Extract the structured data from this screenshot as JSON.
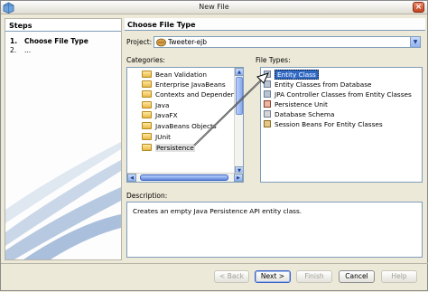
{
  "window": {
    "title": "New File",
    "app_icon": "netbeans-icon",
    "close_label": "×"
  },
  "steps": {
    "header": "Steps",
    "items": [
      {
        "num": "1.",
        "label": "Choose File Type",
        "current": true
      },
      {
        "num": "2.",
        "label": "...",
        "current": false
      }
    ]
  },
  "panel": {
    "header": "Choose File Type",
    "project_label": "Project:",
    "project_value": "Tweeter-ejb",
    "categories_label": "Categories:",
    "filetypes_label": "File Types:",
    "description_label": "Description:",
    "description_text": "Creates an empty Java Persistence API entity class."
  },
  "categories": [
    {
      "label": "Bean Validation",
      "selected": false
    },
    {
      "label": "Enterprise JavaBeans",
      "selected": false
    },
    {
      "label": "Contexts and Dependency",
      "selected": false
    },
    {
      "label": "Java",
      "selected": false
    },
    {
      "label": "JavaFX",
      "selected": false
    },
    {
      "label": "JavaBeans Objects",
      "selected": false
    },
    {
      "label": "JUnit",
      "selected": false
    },
    {
      "label": "Persistence",
      "selected": true
    }
  ],
  "file_types": [
    {
      "label": "Entity Class",
      "selected": true
    },
    {
      "label": "Entity Classes from Database",
      "selected": false
    },
    {
      "label": "JPA Controller Classes from Entity Classes",
      "selected": false
    },
    {
      "label": "Persistence Unit",
      "selected": false
    },
    {
      "label": "Database Schema",
      "selected": false
    },
    {
      "label": "Session Beans For Entity Classes",
      "selected": false
    }
  ],
  "buttons": {
    "back": "< Back",
    "next": "Next >",
    "finish": "Finish",
    "cancel": "Cancel",
    "help": "Help"
  },
  "colors": {
    "selection": "#316ac5",
    "accent": "#7f9db9"
  }
}
